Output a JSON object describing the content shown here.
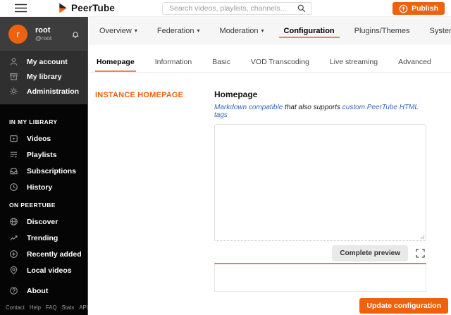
{
  "header": {
    "brand": "PeerTube",
    "search": {
      "placeholder": "Search videos, playlists, channels..."
    },
    "publish_label": "Publish"
  },
  "sidebar": {
    "user": {
      "initial": "r",
      "name": "root",
      "handle": "@root"
    },
    "account_menu": [
      {
        "label": "My account"
      },
      {
        "label": "My library"
      },
      {
        "label": "Administration"
      }
    ],
    "sections": [
      {
        "title": "IN MY LIBRARY",
        "items": [
          {
            "label": "Videos"
          },
          {
            "label": "Playlists"
          },
          {
            "label": "Subscriptions"
          },
          {
            "label": "History"
          }
        ]
      },
      {
        "title": "ON PEERTUBE",
        "items": [
          {
            "label": "Discover"
          },
          {
            "label": "Trending"
          },
          {
            "label": "Recently added"
          },
          {
            "label": "Local videos"
          }
        ]
      }
    ],
    "about_label": "About",
    "footer_links": [
      {
        "label": "Contact"
      },
      {
        "label": "Help"
      },
      {
        "label": "FAQ"
      },
      {
        "label": "Stats"
      },
      {
        "label": "API"
      }
    ]
  },
  "admin_nav": {
    "items": [
      {
        "label": "Overview",
        "caret": true
      },
      {
        "label": "Federation",
        "caret": true
      },
      {
        "label": "Moderation",
        "caret": true
      },
      {
        "label": "Configuration",
        "caret": false,
        "active": true
      },
      {
        "label": "Plugins/Themes",
        "caret": false
      },
      {
        "label": "System",
        "caret": true
      }
    ]
  },
  "config_tabs": [
    {
      "label": "Homepage",
      "active": true
    },
    {
      "label": "Information"
    },
    {
      "label": "Basic"
    },
    {
      "label": "VOD Transcoding"
    },
    {
      "label": "Live streaming"
    },
    {
      "label": "Advanced"
    }
  ],
  "homepage_form": {
    "section_title": "INSTANCE HOMEPAGE",
    "field_label": "Homepage",
    "hint_link_markdown": "Markdown compatible",
    "hint_middle": " that also supports ",
    "hint_link_html": "custom PeerTube HTML tags",
    "textarea_value": "",
    "preview_button_label": "Complete preview",
    "update_button_label": "Update configuration"
  },
  "colors": {
    "primary_orange": "#ee610f",
    "underline_salmon": "#f08356",
    "link_blue": "#3568b8",
    "sidebar_black": "#050505",
    "nav_grey": "#f6f6f6"
  }
}
